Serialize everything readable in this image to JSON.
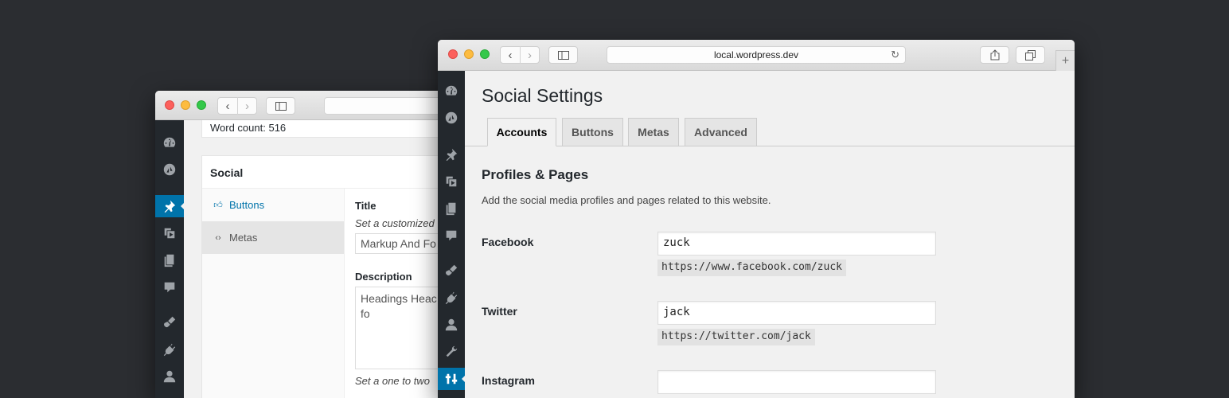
{
  "back_window": {
    "word_count": "Word count: 516",
    "metabox_title": "Social",
    "tabs": [
      {
        "label": "Buttons",
        "icon": "thumbs-up-icon"
      },
      {
        "label": "Metas",
        "icon": "code-icon"
      }
    ],
    "title_label": "Title",
    "title_help": "Set a customized",
    "title_value": "Markup And Fo",
    "description_label": "Description",
    "description_value": "Headings Heac hungry. Stay fo",
    "description_help": "Set a one to two"
  },
  "front_window": {
    "url": "local.wordpress.dev",
    "page_title": "Social Settings",
    "tabs": [
      "Accounts",
      "Buttons",
      "Metas",
      "Advanced"
    ],
    "active_tab": "Accounts",
    "section_title": "Profiles & Pages",
    "section_desc": "Add the social media profiles and pages related to this website.",
    "fields": [
      {
        "label": "Facebook",
        "value": "zuck",
        "url": "https://www.facebook.com/zuck"
      },
      {
        "label": "Twitter",
        "value": "jack",
        "url": "https://twitter.com/jack"
      },
      {
        "label": "Instagram",
        "value": "",
        "url": ""
      }
    ]
  },
  "colors": {
    "desktop": "#2b2d31",
    "wp_sidebar": "#23282d",
    "wp_accent": "#0073aa",
    "link": "#0073aa"
  }
}
